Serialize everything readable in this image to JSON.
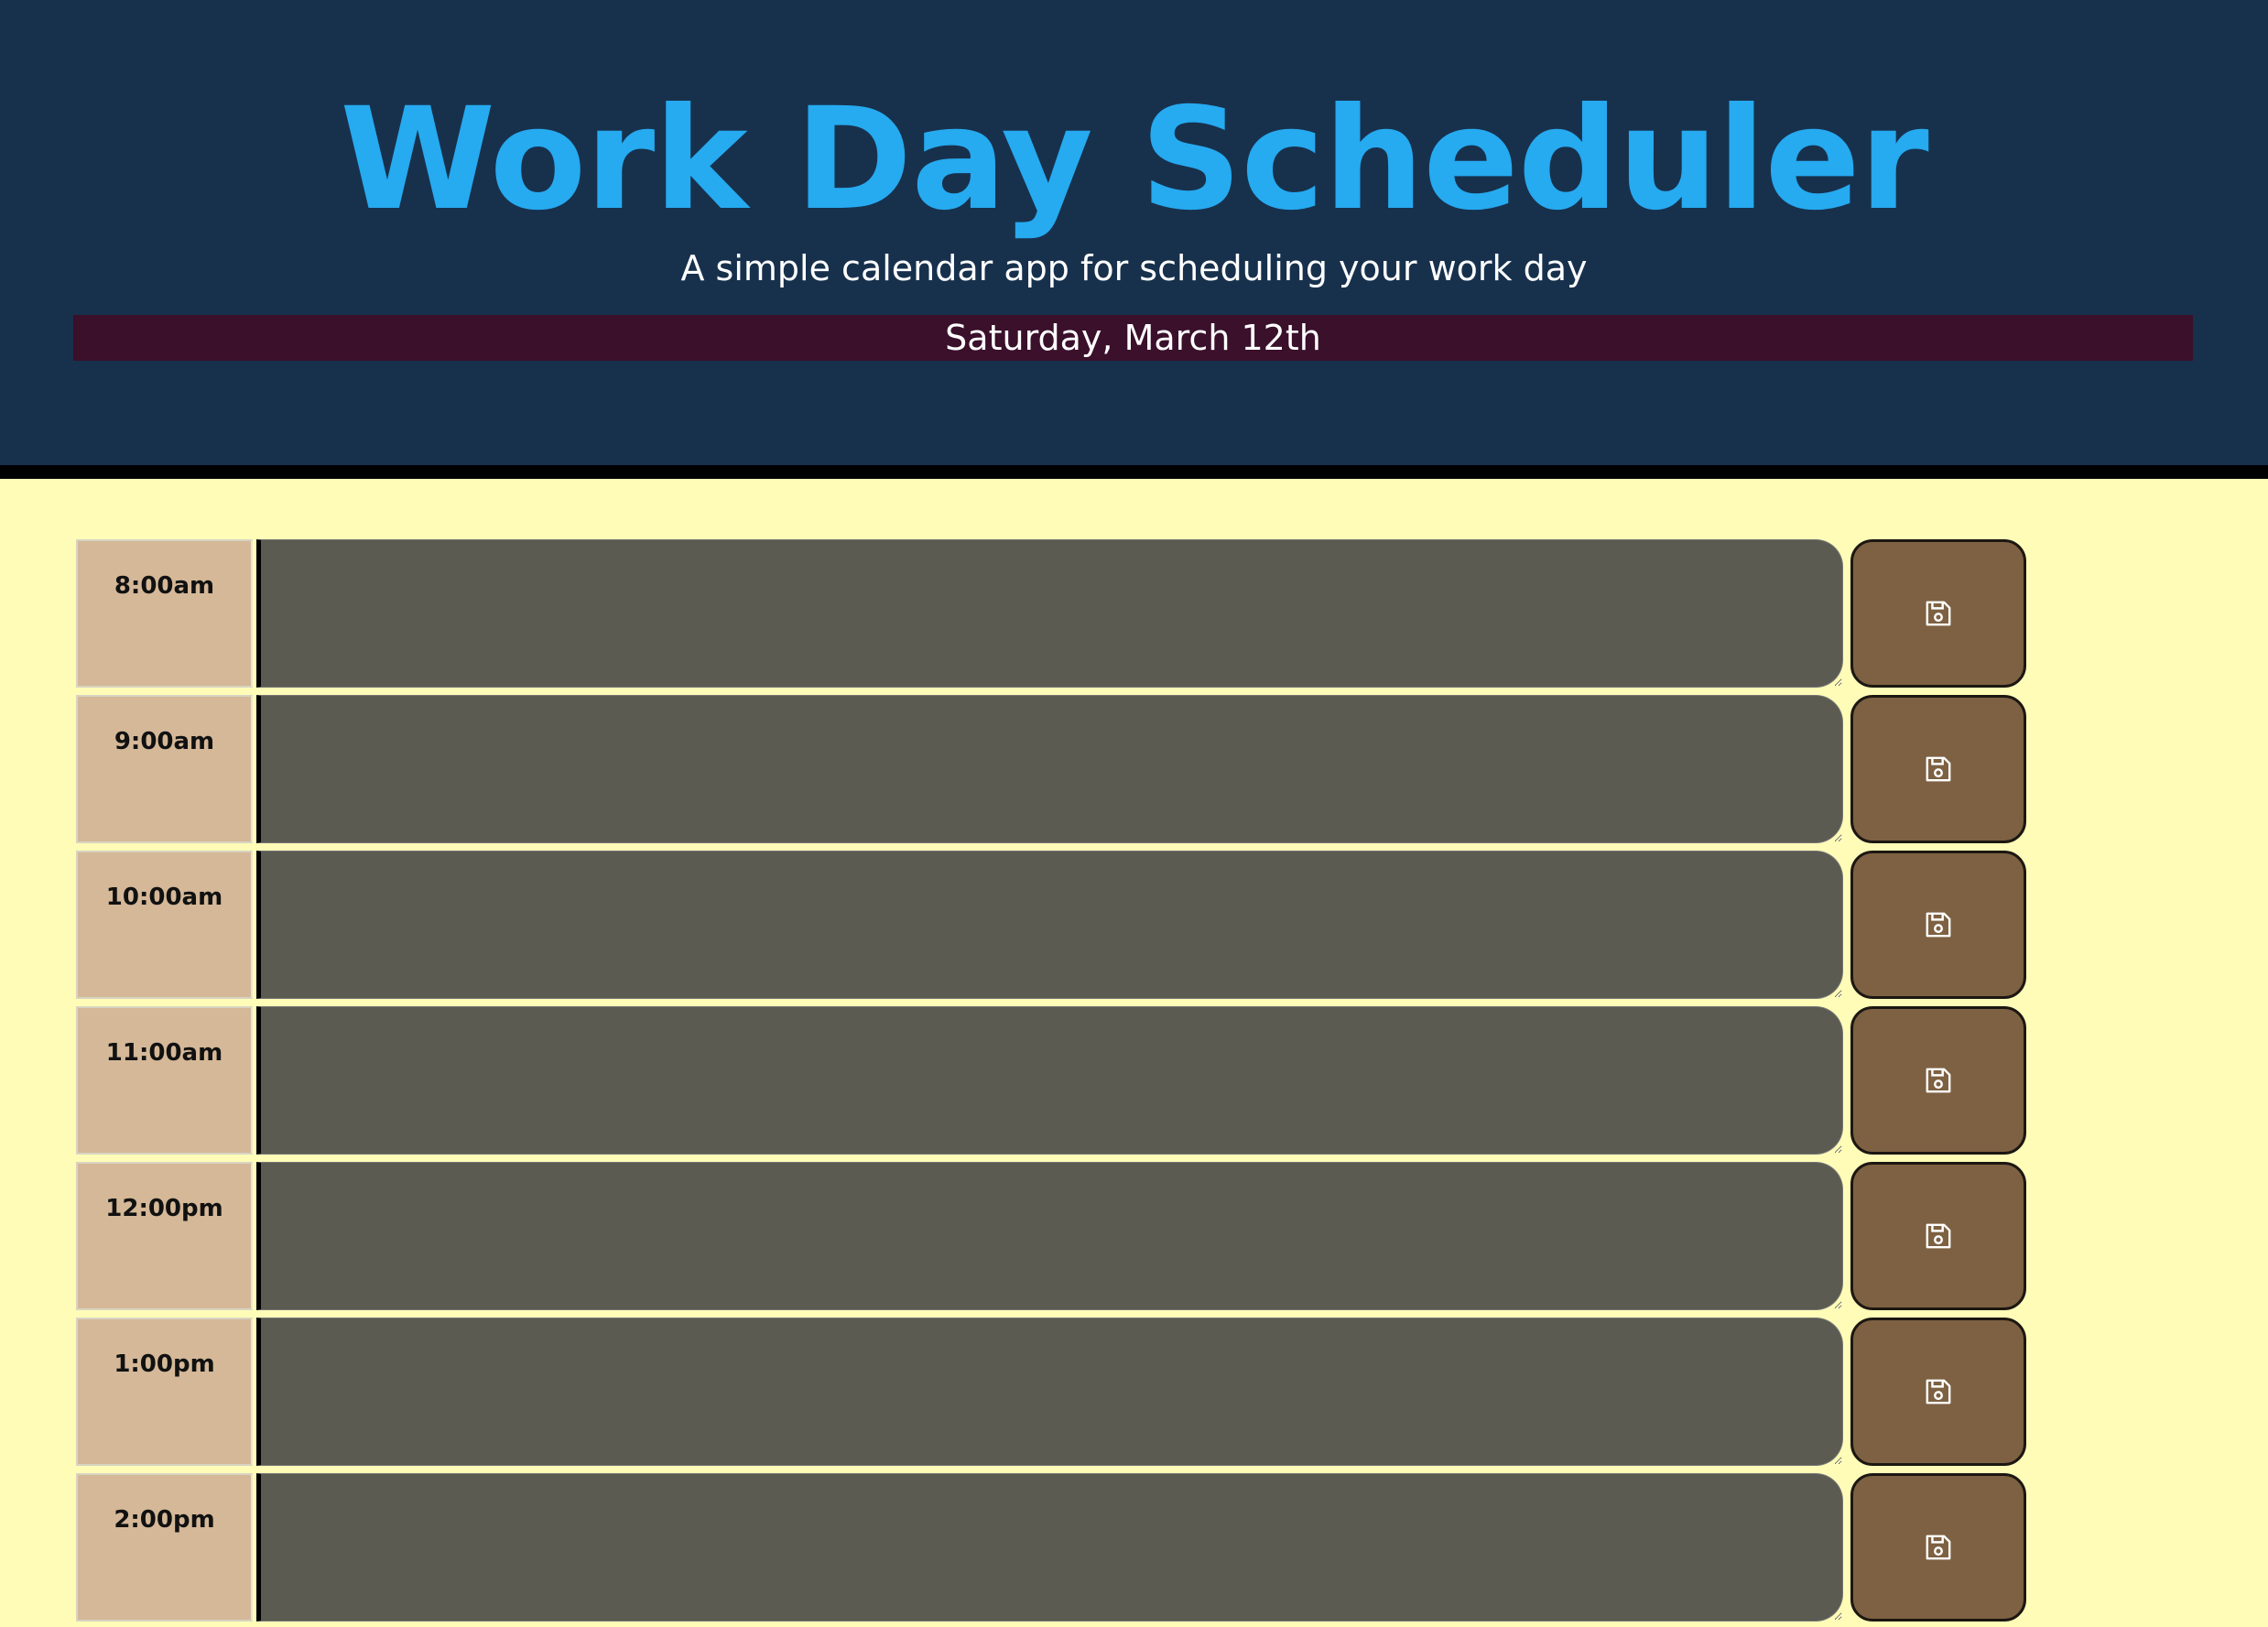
{
  "header": {
    "title": "Work Day Scheduler",
    "subtitle": "A simple calendar app for scheduling your work day",
    "current_date": "Saturday, March 12th"
  },
  "colors": {
    "header_bg": "#17314d",
    "title": "#26aaf0",
    "date_bar": "#3a102b",
    "page_bg": "#fffcb8",
    "hour_cell": "#d4b898",
    "past_textarea": "#5b5b52",
    "save_button": "#7d6142"
  },
  "schedule": {
    "rows": [
      {
        "hour": "8:00am",
        "text": "",
        "status": "past",
        "save_icon": "floppy-disk-icon"
      },
      {
        "hour": "9:00am",
        "text": "",
        "status": "past",
        "save_icon": "floppy-disk-icon"
      },
      {
        "hour": "10:00am",
        "text": "",
        "status": "past",
        "save_icon": "floppy-disk-icon"
      },
      {
        "hour": "11:00am",
        "text": "",
        "status": "past",
        "save_icon": "floppy-disk-icon"
      },
      {
        "hour": "12:00pm",
        "text": "",
        "status": "past",
        "save_icon": "floppy-disk-icon"
      },
      {
        "hour": "1:00pm",
        "text": "",
        "status": "past",
        "save_icon": "floppy-disk-icon"
      },
      {
        "hour": "2:00pm",
        "text": "",
        "status": "past",
        "save_icon": "floppy-disk-icon"
      }
    ]
  }
}
